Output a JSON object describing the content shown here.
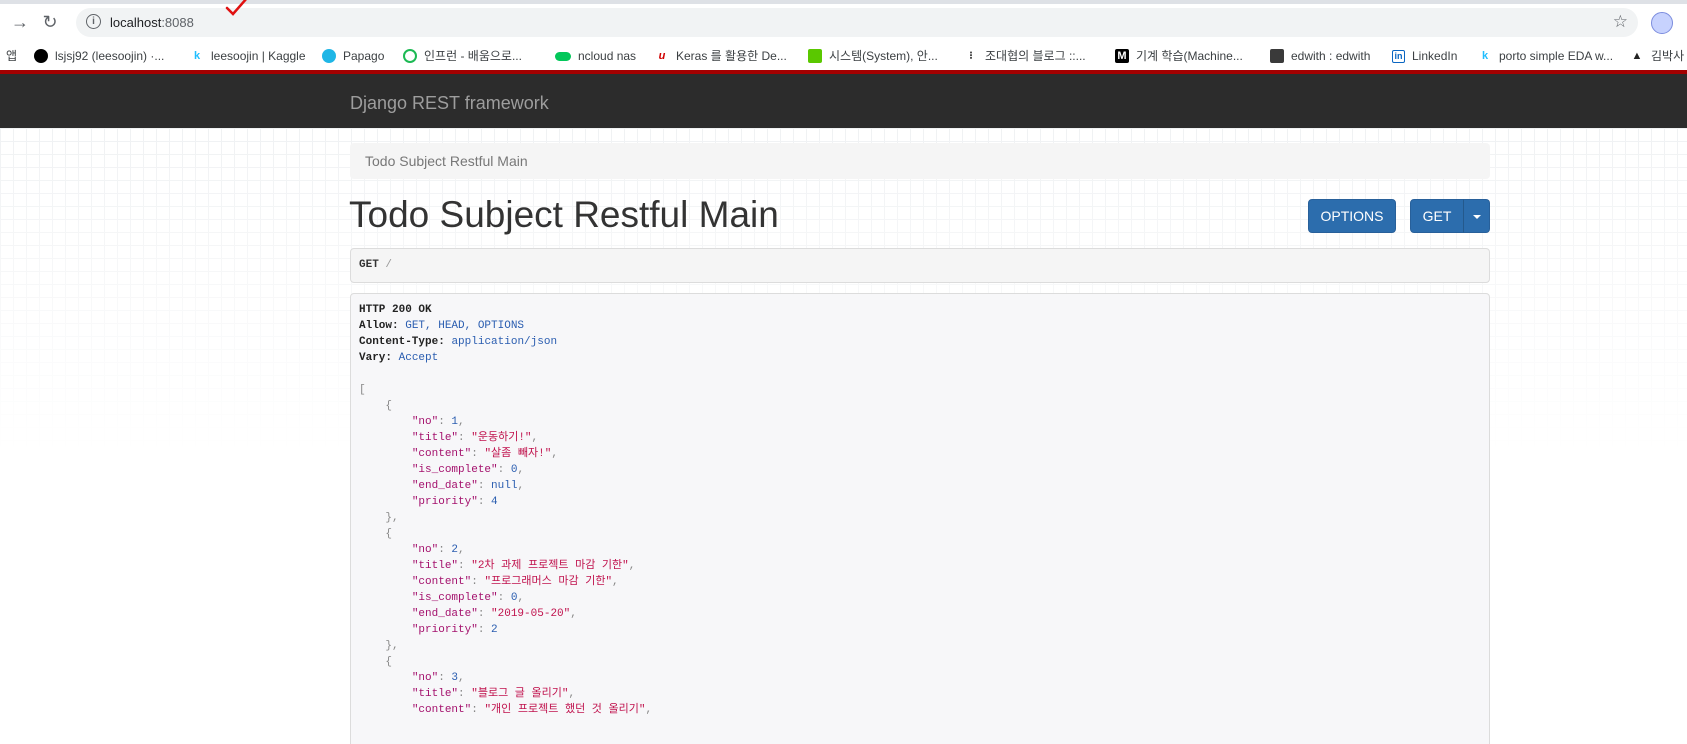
{
  "browser": {
    "url_host": "localhost",
    "url_port": ":8088",
    "bookmarks": [
      {
        "label": "앱",
        "icon": "apps-icon"
      },
      {
        "label": "lsjsj92 (leesoojin) ·...",
        "icon": "github-icon"
      },
      {
        "label": "leesoojin | Kaggle",
        "icon": "kaggle-icon"
      },
      {
        "label": "Papago",
        "icon": "papago-icon"
      },
      {
        "label": "인프런 - 배움으로...",
        "icon": "inflearn-icon"
      },
      {
        "label": "ncloud nas",
        "icon": "ncloud-icon"
      },
      {
        "label": "Keras 를 활용한 De...",
        "icon": "keras-icon"
      },
      {
        "label": "시스템(System), 안...",
        "icon": "blog-icon"
      },
      {
        "label": "조대협의 블로그 ::...",
        "icon": "tistory-icon"
      },
      {
        "label": "기계 학습(Machine...",
        "icon": "medium-icon"
      },
      {
        "label": "edwith : edwith",
        "icon": "edwith-icon"
      },
      {
        "label": "LinkedIn",
        "icon": "linkedin-icon"
      },
      {
        "label": "porto simple EDA w...",
        "icon": "kaggle-icon"
      },
      {
        "label": "김박사",
        "icon": "graduation-cap-icon"
      }
    ]
  },
  "navbar": {
    "brand": "Django REST framework"
  },
  "breadcrumb": {
    "current": "Todo Subject Restful Main"
  },
  "page": {
    "title": "Todo Subject Restful Main"
  },
  "buttons": {
    "options": "OPTIONS",
    "get": "GET"
  },
  "request": {
    "method": "GET",
    "path": "/"
  },
  "response": {
    "status": "HTTP 200 OK",
    "headers": [
      {
        "name": "Allow:",
        "value": "GET, HEAD, OPTIONS"
      },
      {
        "name": "Content-Type:",
        "value": "application/json"
      },
      {
        "name": "Vary:",
        "value": "Accept"
      }
    ],
    "items": [
      {
        "no": "1",
        "title": "\"운동하기!\"",
        "content": "\"살좀 빼자!\"",
        "is_complete": "0",
        "end_date": "null",
        "priority": "4"
      },
      {
        "no": "2",
        "title": "\"2차 과제 프로젝트 마감 기한\"",
        "content": "\"프로그래머스 마감 기한\"",
        "is_complete": "0",
        "end_date": "\"2019-05-20\"",
        "priority": "2"
      },
      {
        "no": "3",
        "title": "\"블로그 글 올리기\"",
        "content": "\"개인 프로젝트 했던 것 올리기\""
      }
    ]
  },
  "colors": {
    "navbar": "#2c2c2c",
    "navbar_accent": "#a30000",
    "button": "#2c6dad"
  }
}
